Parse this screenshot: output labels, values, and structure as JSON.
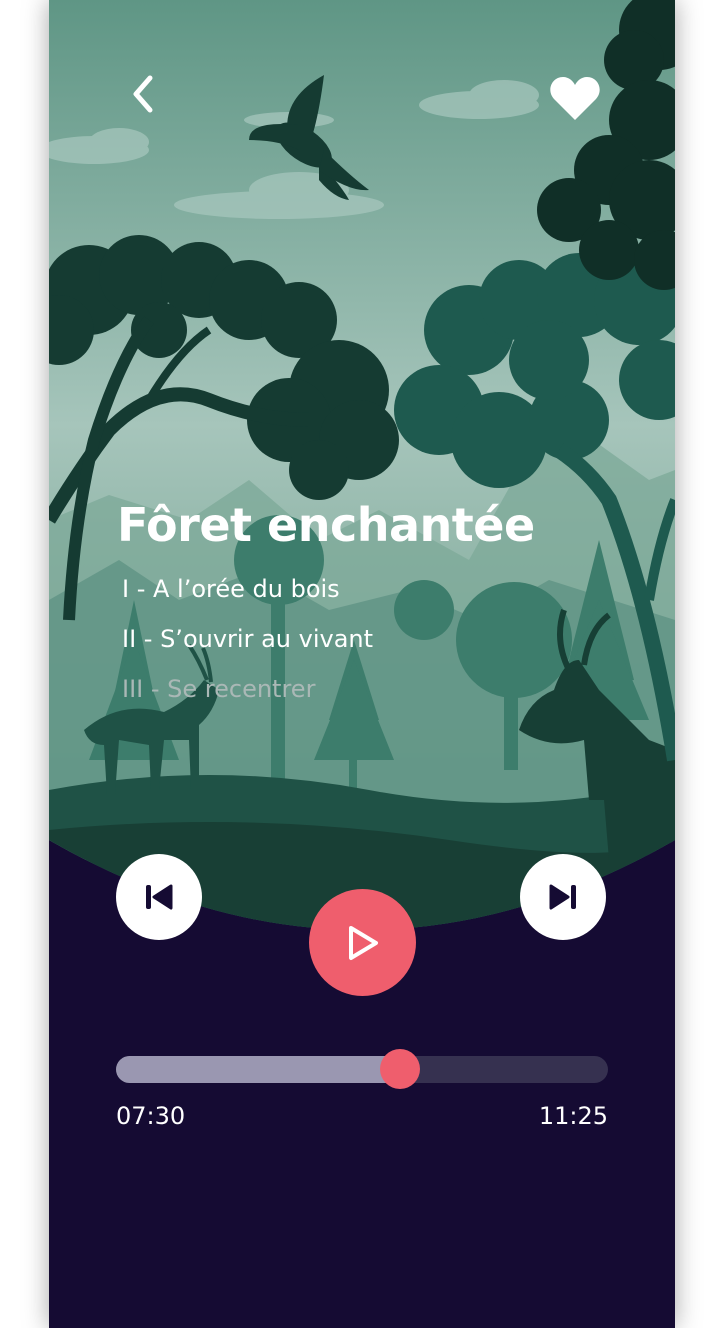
{
  "colors": {
    "background": "#150b33",
    "accent": "#ef5e6d",
    "progress_fill": "#9a97b1",
    "progress_track": "#363150",
    "sky": "#6ca190",
    "foliage_dark": "#153b32",
    "foliage_mid": "#1e5a4f"
  },
  "header": {
    "back_icon": "chevron-left-icon",
    "favorite_icon": "heart-icon"
  },
  "track": {
    "title": "Fôret enchantée",
    "chapters": [
      {
        "label": "I - A l’orée du bois",
        "state": "played"
      },
      {
        "label": "II - S’ouvrir au vivant",
        "state": "current"
      },
      {
        "label": "III - Se recentrer",
        "state": "upcoming"
      }
    ]
  },
  "controls": {
    "previous_icon": "skip-previous-icon",
    "play_icon": "play-icon",
    "next_icon": "skip-next-icon"
  },
  "progress": {
    "elapsed": "07:30",
    "total": "11:25",
    "fraction": 0.577
  }
}
